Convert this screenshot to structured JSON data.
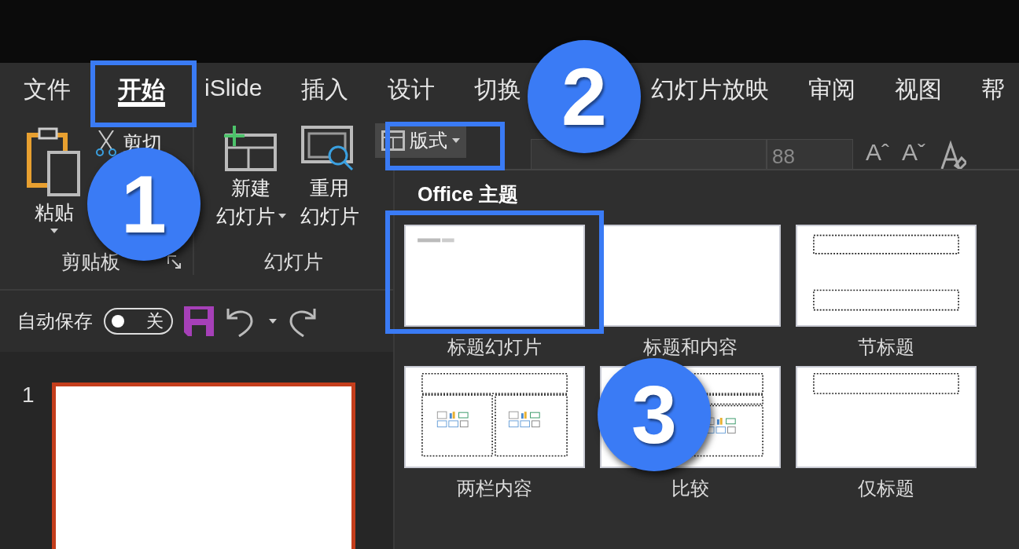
{
  "tabs": [
    {
      "label": "文件",
      "selected": false
    },
    {
      "label": "开始",
      "selected": true
    },
    {
      "label": "iSlide",
      "selected": false
    },
    {
      "label": "插入",
      "selected": false
    },
    {
      "label": "设计",
      "selected": false
    },
    {
      "label": "切换",
      "selected": false
    },
    {
      "label": "幻灯片放映",
      "selected": false
    },
    {
      "label": "审阅",
      "selected": false
    },
    {
      "label": "视图",
      "selected": false
    },
    {
      "label": "帮",
      "selected": false
    }
  ],
  "ribbon": {
    "clipboard": {
      "paste": "粘贴",
      "cut": "剪切",
      "label": "剪贴板"
    },
    "slides": {
      "new_slide": [
        "新建",
        "幻灯片"
      ],
      "reuse_slide": [
        "重用",
        "幻灯片"
      ],
      "label": "幻灯片"
    },
    "layout_button": "版式",
    "font_size": "88",
    "grow_font": "Aˆ",
    "shrink_font": "Aˇ"
  },
  "quick_access": {
    "autosave_label": "自动保存",
    "autosave": {
      "on": false,
      "label": "关"
    }
  },
  "slide_panel": {
    "slides": [
      {
        "number": "1",
        "selected": true
      }
    ]
  },
  "layout_gallery": {
    "title": "Office 主题",
    "layouts": [
      {
        "name": "标题幻灯片",
        "kind": "title"
      },
      {
        "name": "标题和内容",
        "kind": "blank"
      },
      {
        "name": "节标题",
        "kind": "section"
      },
      {
        "name": "两栏内容",
        "kind": "two-content"
      },
      {
        "name": "比较",
        "kind": "comparison"
      },
      {
        "name": "仅标题",
        "kind": "title-only"
      }
    ]
  },
  "annotations": [
    {
      "number": "1"
    },
    {
      "number": "2"
    },
    {
      "number": "3"
    }
  ]
}
